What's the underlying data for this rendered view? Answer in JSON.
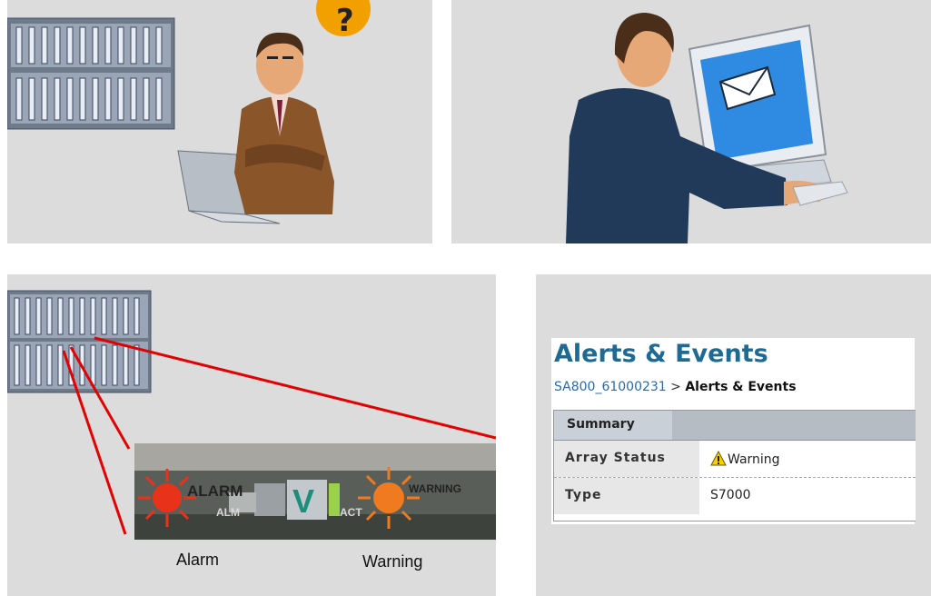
{
  "panels": {
    "top_left": {
      "name": "man-with-laptop-question"
    },
    "top_right": {
      "name": "man-at-computer-email"
    },
    "bottom_left": {
      "led_labels": {
        "alarm_led": "ALARM",
        "warning_led": "WARNING",
        "act_led": "ACT",
        "alm_small": "ALM"
      },
      "captions": {
        "alarm": "Alarm",
        "warning": "Warning"
      }
    },
    "bottom_right": {
      "title": "Alerts & Events",
      "breadcrumb": {
        "link": "SA800_61000231",
        "separator": ">",
        "current": "Alerts & Events"
      },
      "table": {
        "header": "Summary",
        "rows": [
          {
            "key": "Array Status",
            "value": "Warning",
            "icon": "warning-icon"
          },
          {
            "key": "Type",
            "value": "S7000"
          }
        ]
      }
    }
  },
  "colors": {
    "link": "#2a6aa6",
    "title": "#1f6a93",
    "alarm_led": "#e8321a",
    "warning_led": "#f07a20",
    "laser_line": "#e00000",
    "question_badge": "#f2a000"
  }
}
